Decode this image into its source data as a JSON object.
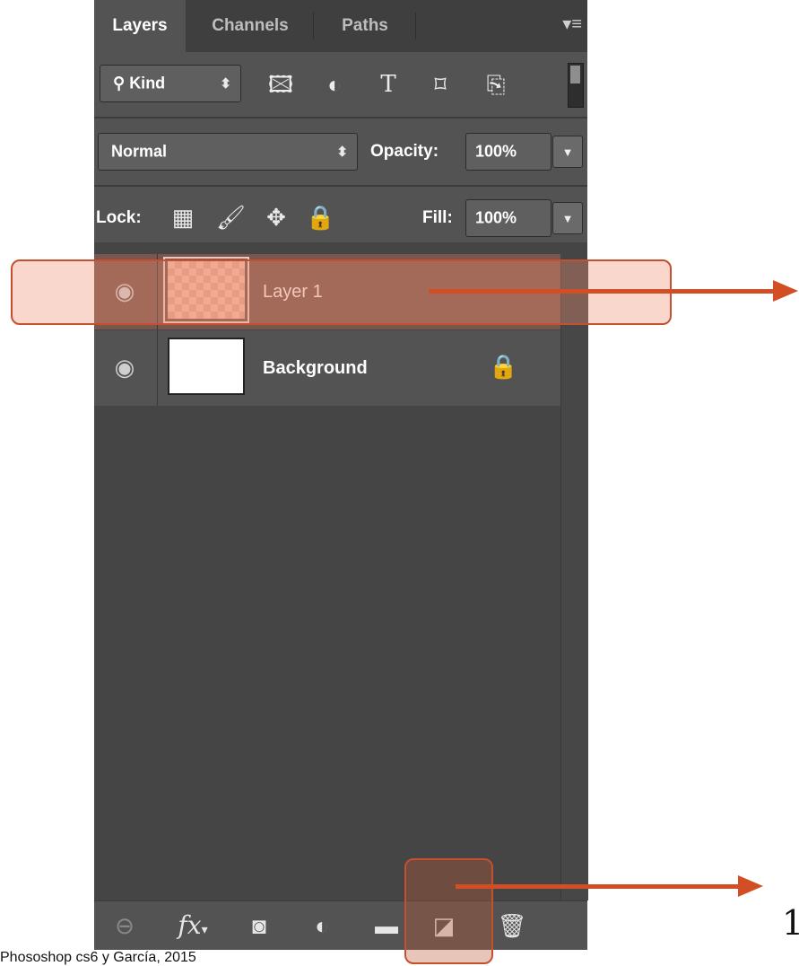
{
  "tabs": [
    "Layers",
    "Channels",
    "Paths"
  ],
  "filter": {
    "kind_label": "Kind",
    "icons": [
      "image-filter-icon",
      "adjustment-filter-icon",
      "type-filter-icon",
      "shape-filter-icon",
      "smart-object-filter-icon"
    ]
  },
  "blend": {
    "mode": "Normal",
    "opacity_label": "Opacity:",
    "opacity_value": "100%"
  },
  "lock": {
    "label": "Lock:",
    "fill_label": "Fill:",
    "fill_value": "100%"
  },
  "layers": [
    {
      "name": "Layer 1",
      "selected": true,
      "thumbnail": "transparent"
    },
    {
      "name": "Background",
      "selected": false,
      "thumbnail": "white",
      "locked": true
    }
  ],
  "bottom_icons": [
    "link-layers-icon",
    "fx-icon",
    "mask-icon",
    "adjustment-layer-icon",
    "folder-icon",
    "new-layer-icon",
    "trash-icon"
  ],
  "fx_label": "fx",
  "annotation": {
    "callout_number": "1",
    "caption": "Phososhop cs6 y García, 2015"
  },
  "colors": {
    "highlight": "#c4502f",
    "arrow": "#d24e24",
    "selected_layer": "#7a564f"
  }
}
